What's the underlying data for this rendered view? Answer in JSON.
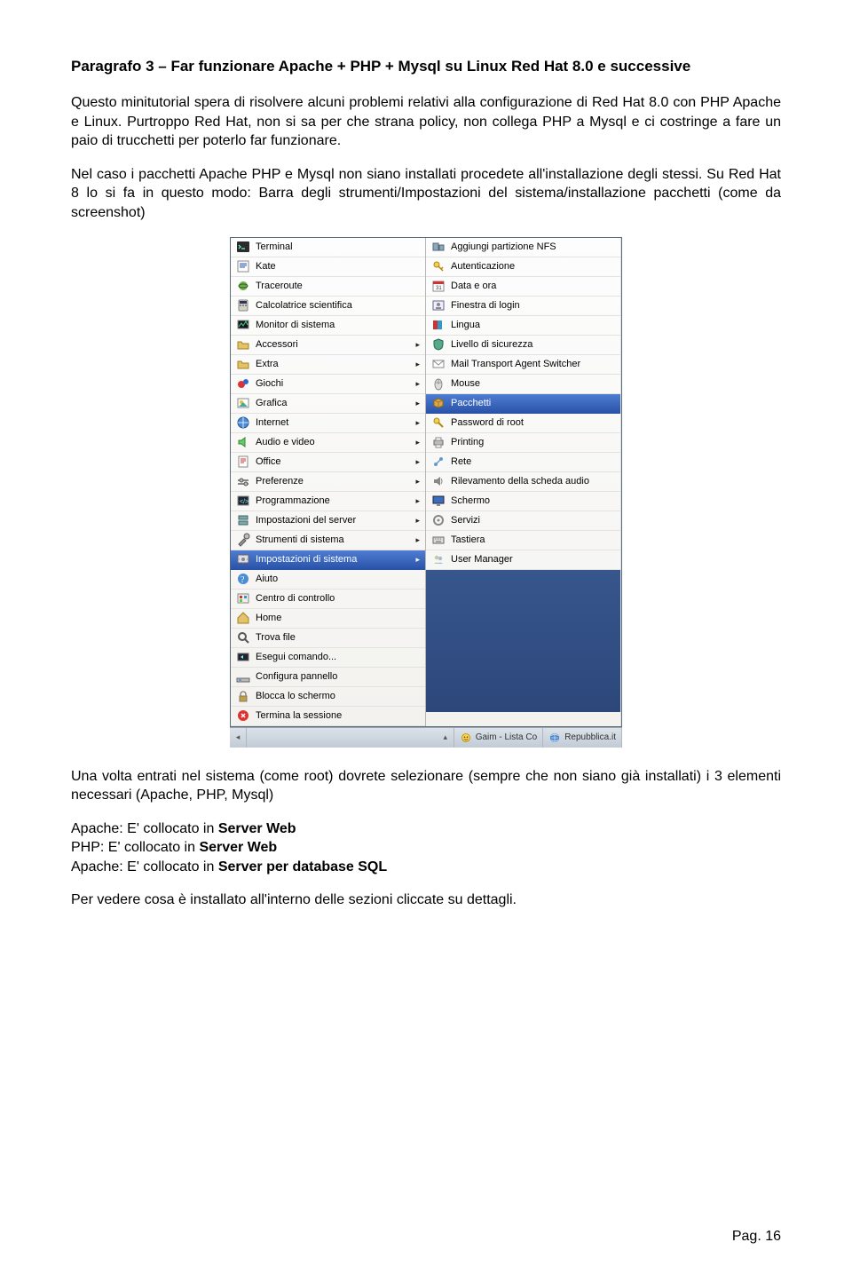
{
  "title_line": "Paragrafo 3 – Far funzionare Apache + PHP + Mysql su Linux Red Hat 8.0 e successive",
  "para1": "Questo minitutorial spera di risolvere alcuni problemi relativi alla configurazione di Red Hat 8.0 con PHP Apache e Linux. Purtroppo Red Hat, non si sa per che strana policy, non collega PHP a Mysql e ci costringe a fare un paio di trucchetti per poterlo far funzionare.",
  "para2": "Nel caso i pacchetti Apache PHP e Mysql non siano installati procedete all'installazione degli stessi. Su Red Hat 8 lo si fa in questo modo: Barra degli strumenti/Impostazioni del sistema/installazione pacchetti (come da screenshot)",
  "menu_left": [
    {
      "icon": "terminal",
      "label": "Terminal",
      "arrow": false
    },
    {
      "icon": "kate",
      "label": "Kate",
      "arrow": false
    },
    {
      "icon": "traceroute",
      "label": "Traceroute",
      "arrow": false
    },
    {
      "icon": "calc",
      "label": "Calcolatrice scientifica",
      "arrow": false
    },
    {
      "icon": "sysmon",
      "label": "Monitor di sistema",
      "arrow": false
    },
    {
      "icon": "folder",
      "label": "Accessori",
      "arrow": true
    },
    {
      "icon": "folder",
      "label": "Extra",
      "arrow": true
    },
    {
      "icon": "games",
      "label": "Giochi",
      "arrow": true
    },
    {
      "icon": "gfx",
      "label": "Grafica",
      "arrow": true
    },
    {
      "icon": "internet",
      "label": "Internet",
      "arrow": true
    },
    {
      "icon": "av",
      "label": "Audio e video",
      "arrow": true
    },
    {
      "icon": "office",
      "label": "Office",
      "arrow": true
    },
    {
      "icon": "prefs",
      "label": "Preferenze",
      "arrow": true
    },
    {
      "icon": "prog",
      "label": "Programmazione",
      "arrow": true
    },
    {
      "icon": "serverset",
      "label": "Impostazioni del server",
      "arrow": true
    },
    {
      "icon": "systools",
      "label": "Strumenti di sistema",
      "arrow": true
    },
    {
      "icon": "sysset",
      "label": "Impostazioni di sistema",
      "arrow": true,
      "selected": true
    },
    {
      "icon": "help",
      "label": "Aiuto",
      "arrow": false
    },
    {
      "icon": "control",
      "label": "Centro di controllo",
      "arrow": false
    },
    {
      "icon": "home",
      "label": "Home",
      "arrow": false
    },
    {
      "icon": "find",
      "label": "Trova file",
      "arrow": false
    },
    {
      "icon": "run",
      "label": "Esegui comando...",
      "arrow": false
    },
    {
      "icon": "panel",
      "label": "Configura pannello",
      "arrow": false
    },
    {
      "icon": "lock",
      "label": "Blocca lo schermo",
      "arrow": false
    },
    {
      "icon": "logout",
      "label": "Termina la sessione",
      "arrow": false
    }
  ],
  "menu_right": [
    {
      "icon": "nfs",
      "label": "Aggiungi partizione NFS"
    },
    {
      "icon": "auth",
      "label": "Autenticazione"
    },
    {
      "icon": "date",
      "label": "Data e ora"
    },
    {
      "icon": "login",
      "label": "Finestra di login"
    },
    {
      "icon": "lang",
      "label": "Lingua"
    },
    {
      "icon": "sec",
      "label": "Livello di sicurezza"
    },
    {
      "icon": "mail",
      "label": "Mail Transport Agent Switcher"
    },
    {
      "icon": "mouse",
      "label": "Mouse"
    },
    {
      "icon": "pkg",
      "label": "Pacchetti",
      "selected": true
    },
    {
      "icon": "rootpw",
      "label": "Password di root"
    },
    {
      "icon": "print",
      "label": "Printing"
    },
    {
      "icon": "net",
      "label": "Rete"
    },
    {
      "icon": "sound",
      "label": "Rilevamento della scheda audio"
    },
    {
      "icon": "screen",
      "label": "Schermo"
    },
    {
      "icon": "services",
      "label": "Servizi"
    },
    {
      "icon": "keyboard",
      "label": "Tastiera"
    },
    {
      "icon": "users",
      "label": "User Manager"
    }
  ],
  "taskbar": {
    "gaim": "Gaim - Lista Co",
    "rep": "Repubblica.it"
  },
  "para_after": "Una volta entrati nel sistema (come root) dovrete selezionare (sempre che non siano già installati) i 3 elementi necessari (Apache, PHP, Mysql)",
  "apache_line_prefix": "Apache: E' collocato in ",
  "apache_line_bold": "Server Web",
  "php_line_prefix": "PHP: E' collocato in ",
  "php_line_bold": "Server Web",
  "apache2_line_prefix": "Apache: E' collocato in ",
  "apache2_line_bold": "Server per database SQL",
  "para_last": "Per vedere cosa è installato all'interno delle sezioni cliccate su dettagli.",
  "page_num": "Pag. 16"
}
